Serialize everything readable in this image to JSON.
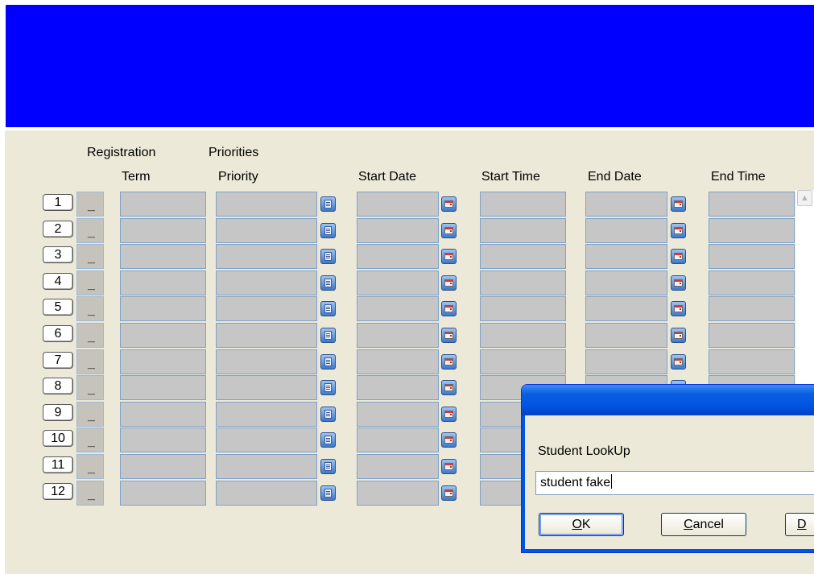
{
  "headers": {
    "registration": "Registration",
    "priorities": "Priorities",
    "term": "Term",
    "priority": "Priority",
    "start_date": "Start Date",
    "start_time": "Start Time",
    "end_date": "End Date",
    "end_time": "End Time"
  },
  "rows": [
    {
      "num": "1",
      "sel": "_"
    },
    {
      "num": "2",
      "sel": "_"
    },
    {
      "num": "3",
      "sel": "_"
    },
    {
      "num": "4",
      "sel": "_"
    },
    {
      "num": "5",
      "sel": "_"
    },
    {
      "num": "6",
      "sel": "_"
    },
    {
      "num": "7",
      "sel": "_"
    },
    {
      "num": "8",
      "sel": "_"
    },
    {
      "num": "9",
      "sel": "_"
    },
    {
      "num": "10",
      "sel": "_"
    },
    {
      "num": "11",
      "sel": "_"
    },
    {
      "num": "12",
      "sel": "_"
    }
  ],
  "icons": {
    "priority_lookup": "list-lookup-icon",
    "calendar": "calendar-icon",
    "scroll_up": "scroll-up-arrow-icon"
  },
  "dialog": {
    "label": "Student LookUp",
    "input_value": "student fake",
    "ok_label_mnemonic": "O",
    "ok_label_rest": "K",
    "cancel_label_mnemonic": "C",
    "cancel_label_rest": "ancel",
    "third_label_mnemonic": "D"
  },
  "colors": {
    "banner": "#0000FF",
    "background": "#ECE9D8",
    "cell": "#C6C6C6",
    "dialog_title": "#0054E3"
  }
}
